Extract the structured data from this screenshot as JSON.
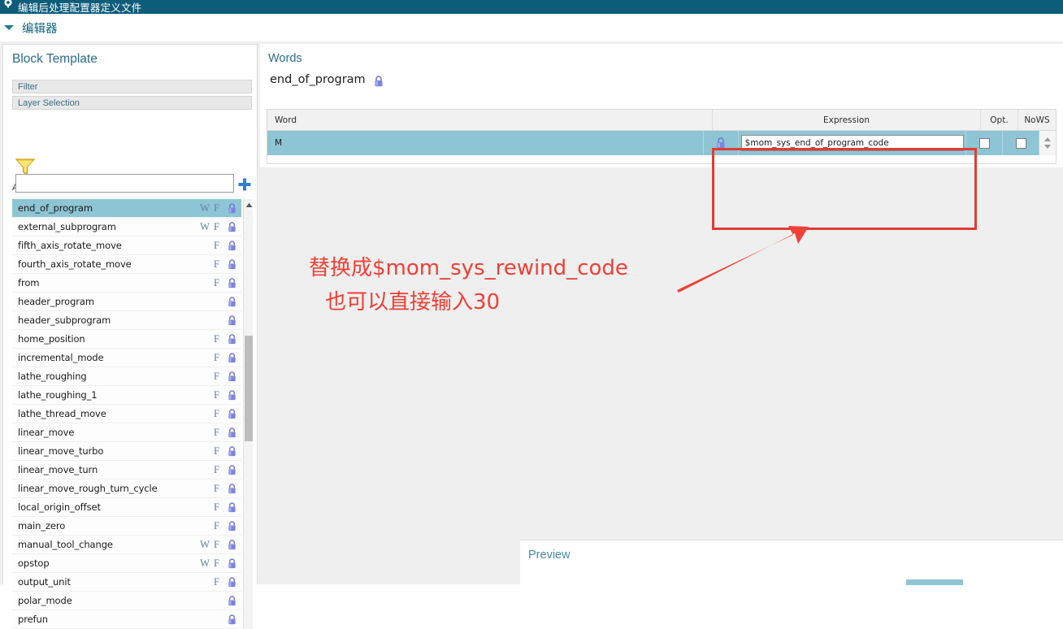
{
  "titlebar": {
    "icon": "gear-icon",
    "title": "编辑后处理配置器定义文件"
  },
  "subheader": {
    "expander_icon": "triangle-down-icon",
    "label": "编辑器"
  },
  "left_panel": {
    "title": "Block Template",
    "sections": [
      {
        "label": "Filter"
      },
      {
        "label": "Layer Selection"
      }
    ],
    "funnel_icon": "funnel-icon",
    "hidden_label": "A",
    "search": {
      "value": "",
      "placeholder": ""
    },
    "add_icon": "plus-icon",
    "scroll_up_icon": "caret-up-icon",
    "items": [
      {
        "name": "end_of_program",
        "w": "W",
        "f": "F",
        "lock": "lock-icon",
        "selected": true
      },
      {
        "name": "external_subprogram",
        "w": "W",
        "f": "F",
        "lock": "lock-icon",
        "selected": false
      },
      {
        "name": "fifth_axis_rotate_move",
        "w": "",
        "f": "F",
        "lock": "lock-icon",
        "selected": false
      },
      {
        "name": "fourth_axis_rotate_move",
        "w": "",
        "f": "F",
        "lock": "lock-icon",
        "selected": false
      },
      {
        "name": "from",
        "w": "",
        "f": "F",
        "lock": "lock-icon",
        "selected": false
      },
      {
        "name": "header_program",
        "w": "",
        "f": "",
        "lock": "lock-icon",
        "selected": false
      },
      {
        "name": "header_subprogram",
        "w": "",
        "f": "",
        "lock": "lock-icon",
        "selected": false
      },
      {
        "name": "home_position",
        "w": "",
        "f": "F",
        "lock": "lock-icon",
        "selected": false
      },
      {
        "name": "incremental_mode",
        "w": "",
        "f": "F",
        "lock": "lock-icon",
        "selected": false
      },
      {
        "name": "lathe_roughing",
        "w": "",
        "f": "F",
        "lock": "lock-icon",
        "selected": false
      },
      {
        "name": "lathe_roughing_1",
        "w": "",
        "f": "F",
        "lock": "lock-icon",
        "selected": false
      },
      {
        "name": "lathe_thread_move",
        "w": "",
        "f": "F",
        "lock": "lock-icon",
        "selected": false
      },
      {
        "name": "linear_move",
        "w": "",
        "f": "F",
        "lock": "lock-icon",
        "selected": false
      },
      {
        "name": "linear_move_turbo",
        "w": "",
        "f": "F",
        "lock": "lock-icon",
        "selected": false
      },
      {
        "name": "linear_move_turn",
        "w": "",
        "f": "F",
        "lock": "lock-icon",
        "selected": false
      },
      {
        "name": "linear_move_rough_turn_cycle",
        "w": "",
        "f": "F",
        "lock": "lock-icon",
        "selected": false
      },
      {
        "name": "local_origin_offset",
        "w": "",
        "f": "F",
        "lock": "lock-icon",
        "selected": false
      },
      {
        "name": "main_zero",
        "w": "",
        "f": "F",
        "lock": "lock-icon",
        "selected": false
      },
      {
        "name": "manual_tool_change",
        "w": "W",
        "f": "F",
        "lock": "lock-icon",
        "selected": false
      },
      {
        "name": "opstop",
        "w": "W",
        "f": "F",
        "lock": "lock-icon",
        "selected": false
      },
      {
        "name": "output_unit",
        "w": "",
        "f": "F",
        "lock": "lock-icon",
        "selected": false
      },
      {
        "name": "polar_mode",
        "w": "",
        "f": "",
        "lock": "lock-icon",
        "selected": false
      },
      {
        "name": "prefun",
        "w": "",
        "f": "",
        "lock": "lock-icon",
        "selected": false
      }
    ]
  },
  "words_panel": {
    "title": "Words",
    "block_name": "end_of_program",
    "block_lock_icon": "lock-icon",
    "add_icon": "plus-icon",
    "close_icon": "close-icon",
    "columns": [
      {
        "key": "word",
        "label": "Word"
      },
      {
        "key": "expression",
        "label": "Expression"
      },
      {
        "key": "opt",
        "label": "Opt."
      },
      {
        "key": "nows",
        "label": "NoWS"
      }
    ],
    "rows": [
      {
        "word": "M",
        "lock_icon": "lock-icon",
        "expression": "$mom_sys_end_of_program_code",
        "opt_checked": false,
        "nows_checked": false,
        "selected": true
      }
    ],
    "spinner_up_icon": "caret-up-icon",
    "spinner_down_icon": "caret-down-icon"
  },
  "annotation": {
    "color": "#ef4037",
    "line1": "替换成$mom_sys_rewind_code",
    "line2": "也可以直接输入30",
    "box_name": "expression-highlight-box",
    "arrow_name": "callout-arrow"
  },
  "preview": {
    "title": "Preview"
  },
  "colors": {
    "titlebar_bg": "#0d5c7a",
    "panel_title": "#2b6c88",
    "selection": "#8ec5d4",
    "annotation_red": "#ef4037",
    "workspace_bg": "#efefef"
  }
}
